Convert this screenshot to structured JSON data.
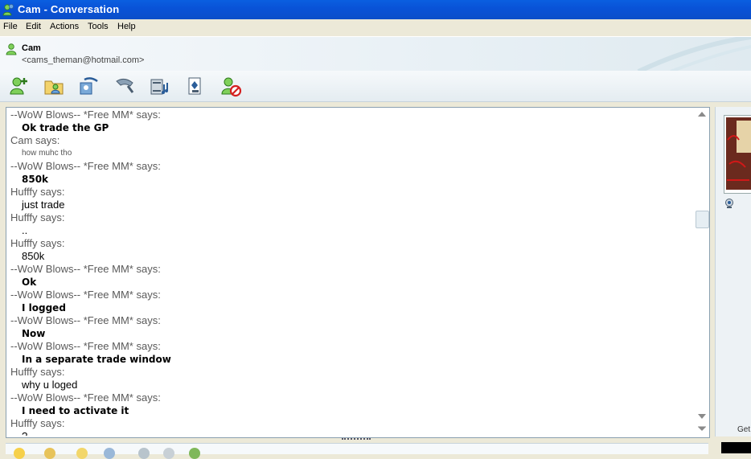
{
  "window": {
    "title": "Cam - Conversation"
  },
  "menu": [
    "File",
    "Edit",
    "Actions",
    "Tools",
    "Help"
  ],
  "contact": {
    "name": "Cam",
    "email": "<cams_theman@hotmail.com>"
  },
  "toolbar_icons": [
    "add-contact-icon",
    "share-files-icon",
    "video-call-icon",
    "voice-call-icon",
    "activities-icon",
    "games-icon",
    "block-icon"
  ],
  "messages": [
    {
      "sender": "--WoW Blows-- *Free MM* says:",
      "text": "Ok trade the GP",
      "style": "bold"
    },
    {
      "sender": "Cam says:",
      "text": "how muhc tho",
      "style": "small"
    },
    {
      "sender": "--WoW Blows-- *Free MM* says:",
      "text": "850k",
      "style": "bold"
    },
    {
      "sender": "Hufffy says:",
      "text": "just trade",
      "style": "normal"
    },
    {
      "sender": "Hufffy says:",
      "text": "..",
      "style": "normal"
    },
    {
      "sender": "Hufffy says:",
      "text": "850k",
      "style": "normal"
    },
    {
      "sender": "--WoW Blows-- *Free MM* says:",
      "text": "Ok",
      "style": "bold"
    },
    {
      "sender": "--WoW Blows-- *Free MM* says:",
      "text": "I logged",
      "style": "bold"
    },
    {
      "sender": "--WoW Blows-- *Free MM* says:",
      "text": "Now",
      "style": "bold"
    },
    {
      "sender": "--WoW Blows-- *Free MM* says:",
      "text": "In a separate trade window",
      "style": "bold"
    },
    {
      "sender": "Hufffy says:",
      "text": "why u loged",
      "style": "normal"
    },
    {
      "sender": "--WoW Blows-- *Free MM* says:",
      "text": "I need to activate it",
      "style": "bold"
    },
    {
      "sender": "Hufffy says:",
      "text": "?",
      "style": "normal"
    }
  ],
  "sidebar": {
    "get_label": "Get"
  }
}
